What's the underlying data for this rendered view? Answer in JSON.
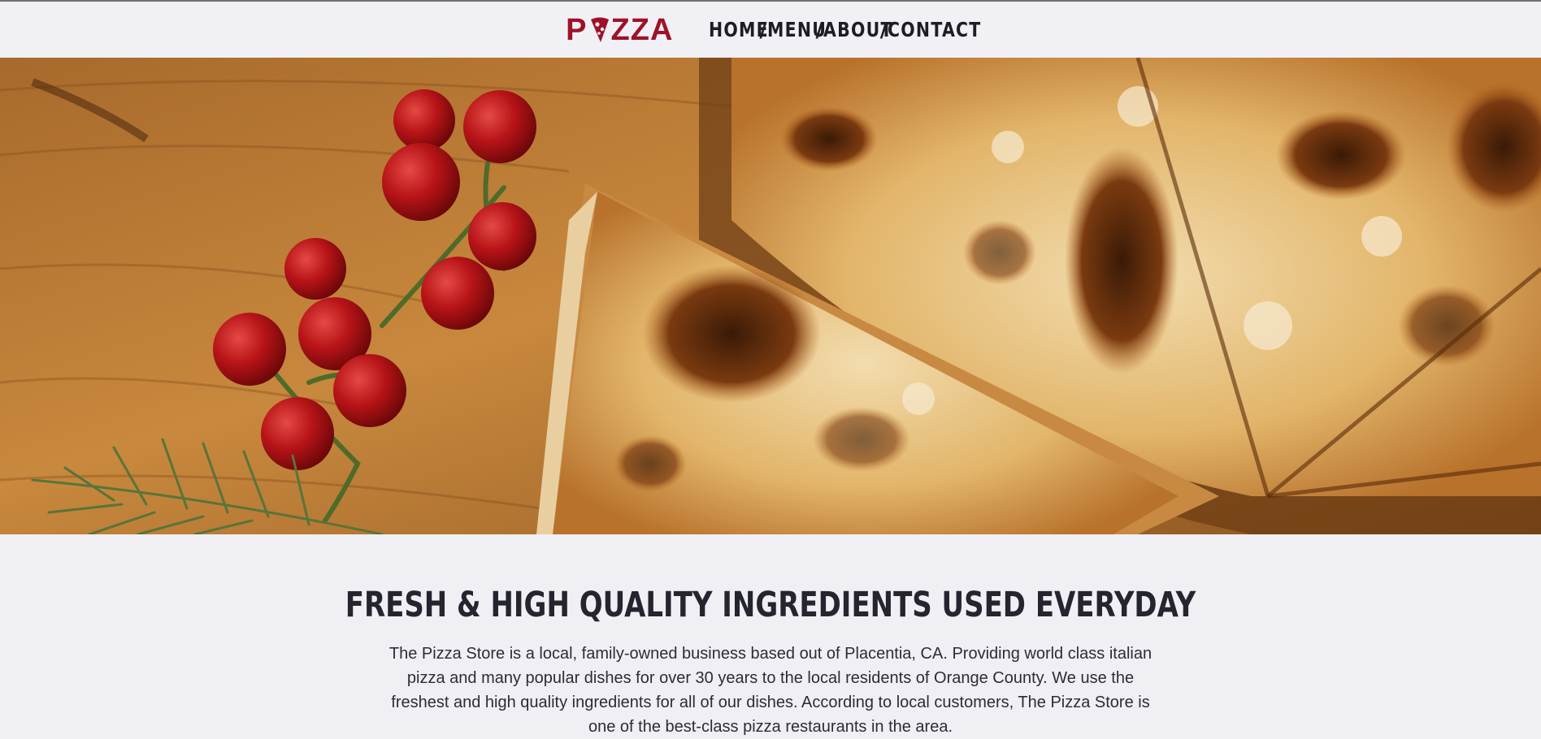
{
  "brand": {
    "logo_text_left": "P",
    "logo_text_right": "ZZA",
    "logo_color": "#9e1228",
    "logo_icon": "pizza-slice-icon"
  },
  "nav": {
    "items": [
      {
        "label": "HOME",
        "separator": " /"
      },
      {
        "label": "MENU",
        "separator": " /"
      },
      {
        "label": "ABOUT",
        "separator": " /"
      },
      {
        "label": "CONTACT",
        "separator": ""
      }
    ]
  },
  "hero": {
    "image_icon": "pizza-hero-image"
  },
  "main": {
    "heading": "FRESH & HIGH QUALITY INGREDIENTS USED EVERYDAY",
    "description": "The Pizza Store is a local, family-owned business based out of Placentia, CA. Providing world class italian pizza and many popular dishes for over 30 years to the local residents of Orange County. We use the freshest and high quality ingredients for all of our dishes. According to local customers, The Pizza Store is one of the best-class pizza restaurants in the area."
  },
  "colors": {
    "background": "#f0f0f4",
    "text": "#24252f",
    "accent": "#9e1228"
  }
}
